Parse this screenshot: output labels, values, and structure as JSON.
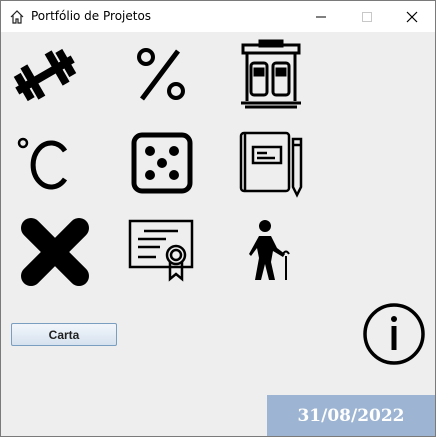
{
  "window": {
    "title": "Portfólio de Projetos",
    "controls": [
      "minimize",
      "maximize",
      "close"
    ]
  },
  "icons": [
    {
      "name": "dumbbell-icon"
    },
    {
      "name": "percent-icon"
    },
    {
      "name": "gas-station-icon"
    },
    {
      "name": "celsius-icon"
    },
    {
      "name": "dice-icon"
    },
    {
      "name": "notebook-pencil-icon"
    },
    {
      "name": "x-cross-icon"
    },
    {
      "name": "certificate-icon"
    },
    {
      "name": "elderly-person-icon"
    }
  ],
  "carta_button": {
    "label": "Carta"
  },
  "info_button": {
    "icon": "info-icon"
  },
  "date": {
    "text": "31/08/2022"
  },
  "colors": {
    "window_bg": "#eeeeee",
    "date_bg": "#9db5d3",
    "date_text": "#ffffff"
  }
}
